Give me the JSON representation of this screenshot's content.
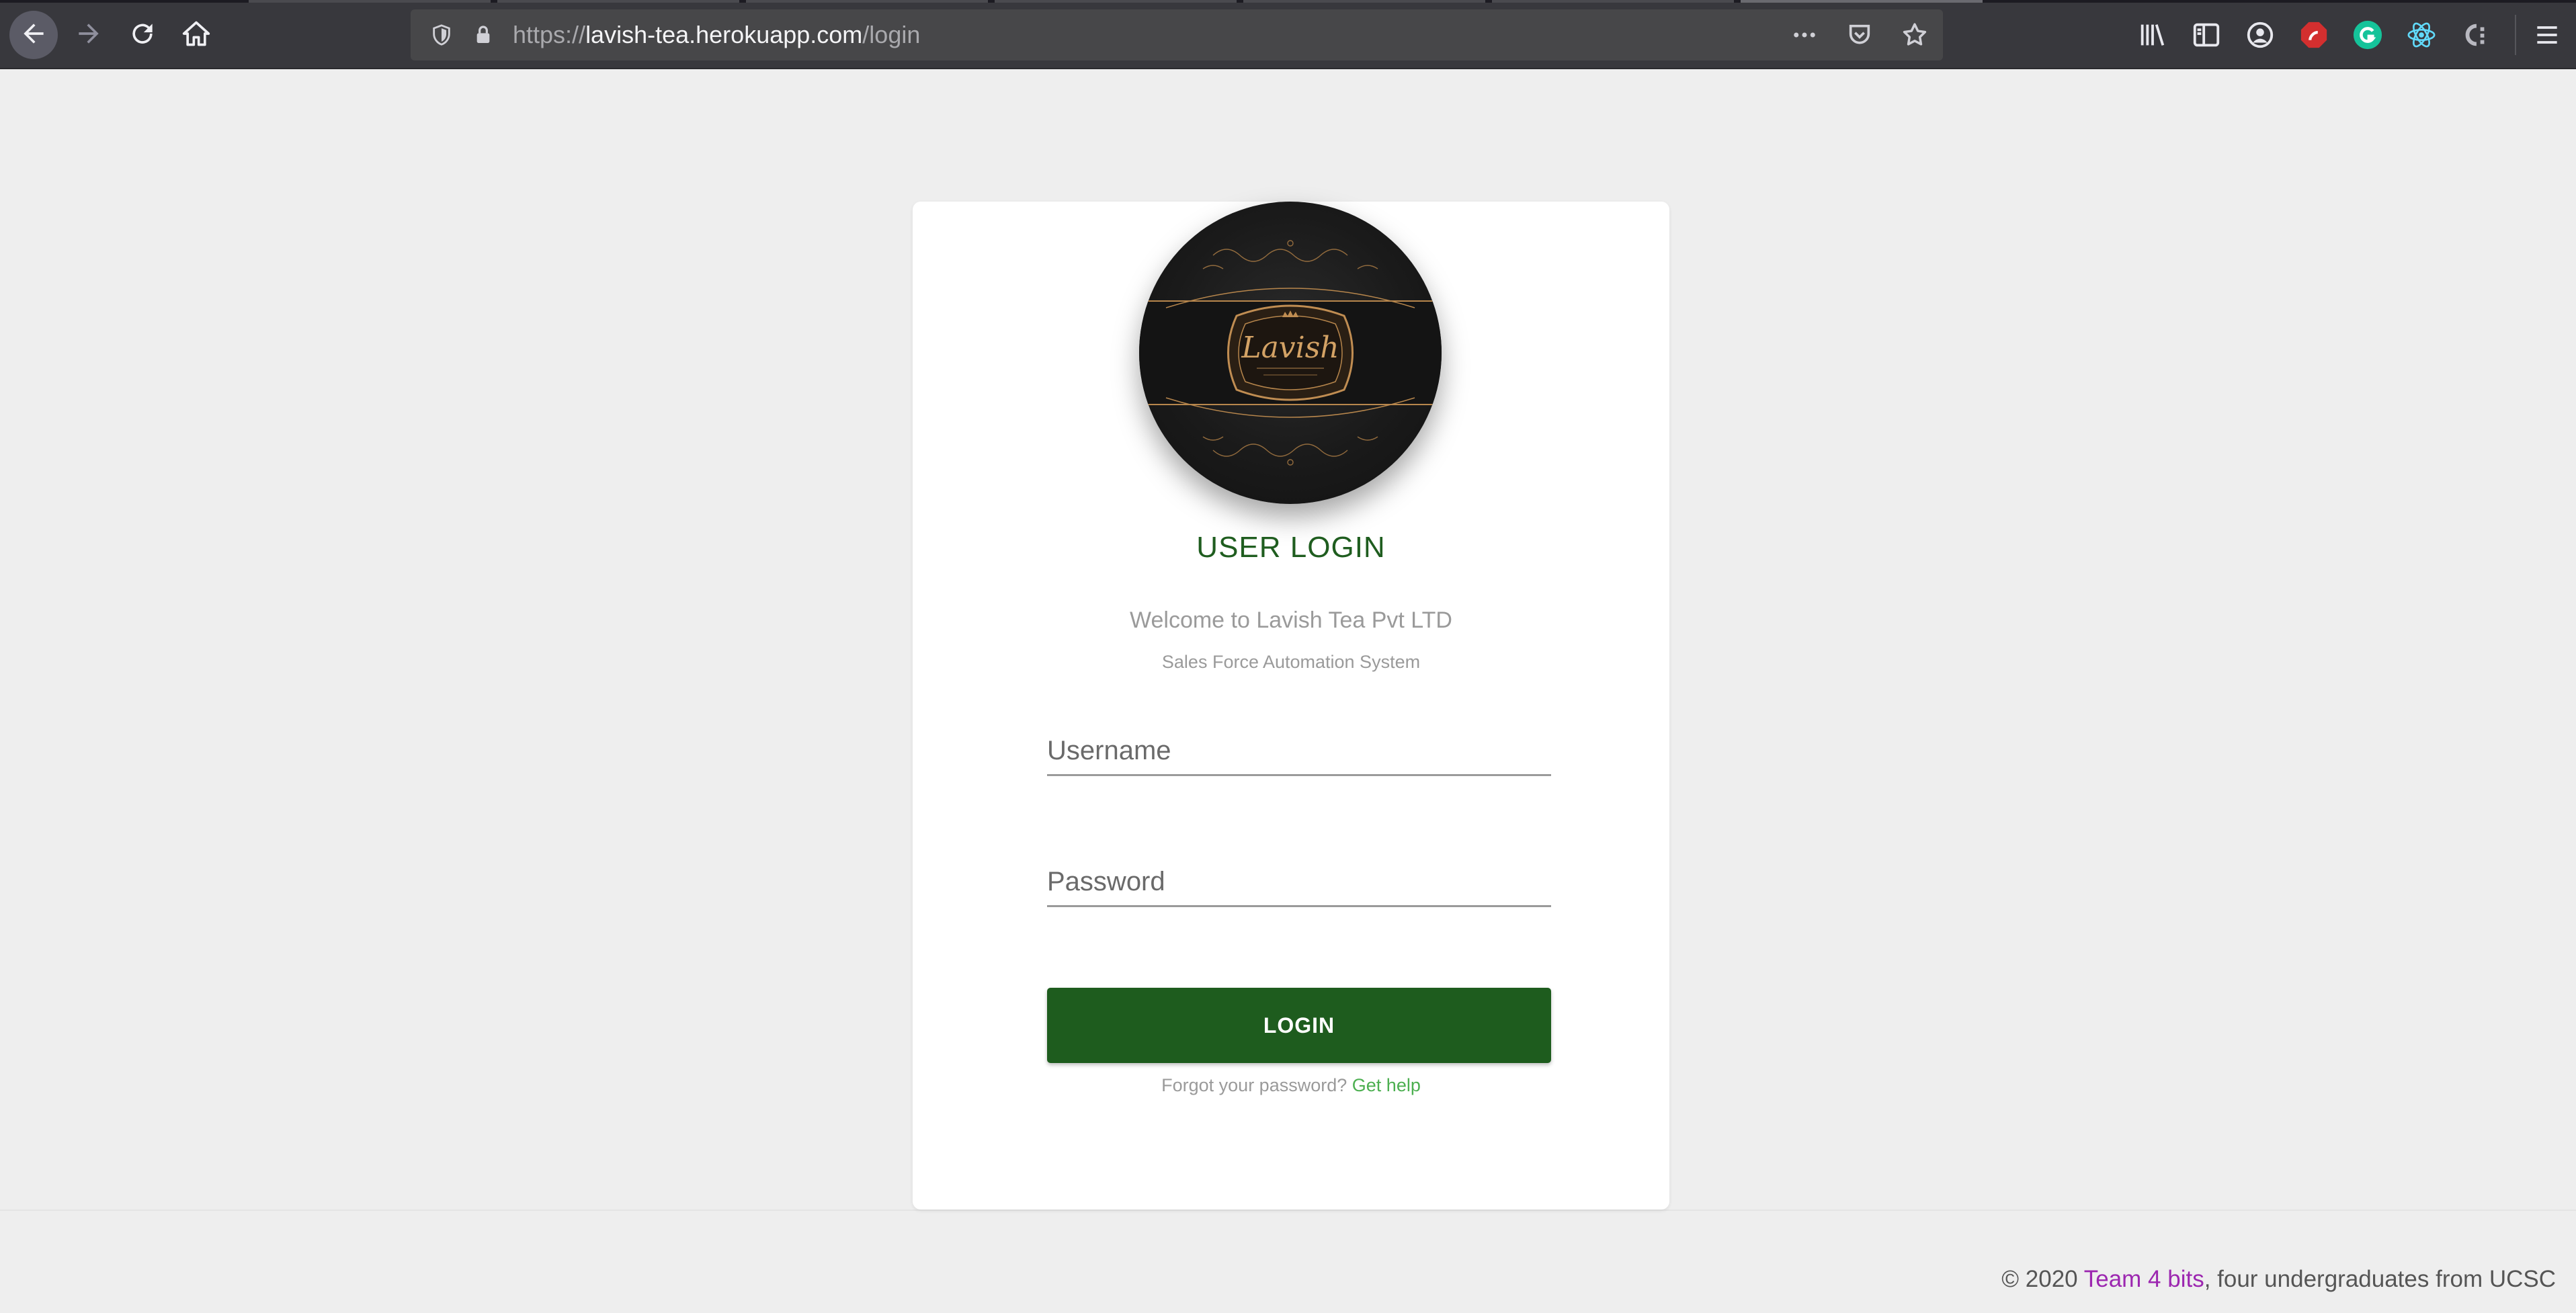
{
  "browser": {
    "url_scheme": "https://",
    "url_host": "lavish-tea.herokuapp.com",
    "url_path": "/login",
    "icons": {
      "back": "back-arrow-icon",
      "forward": "forward-arrow-icon",
      "reload": "reload-icon",
      "home": "home-icon",
      "tracking": "shield-icon",
      "lock": "lock-icon",
      "more": "more-dots-icon",
      "pocket": "pocket-icon",
      "bookmark": "star-icon",
      "library": "library-icon",
      "sidebar": "sidebar-icon",
      "account": "account-icon",
      "menu": "hamburger-menu-icon"
    },
    "extensions": [
      "adblock-icon",
      "grammarly-icon",
      "react-devtools-icon",
      "css-extension-icon"
    ]
  },
  "login": {
    "logo_alt": "Lavish",
    "title": "USER LOGIN",
    "welcome": "Welcome to Lavish Tea Pvt LTD",
    "subtitle": "Sales Force Automation System",
    "username_placeholder": "Username",
    "password_placeholder": "Password",
    "login_button": "LOGIN",
    "forgot_text": "Forgot your password?",
    "help_link": "Get help"
  },
  "footer": {
    "copyright": "© 2020",
    "team_link": "Team 4 bits",
    "rest": ", four undergraduates from UCSC"
  },
  "colors": {
    "accent_green": "#1e5c1e",
    "help_green": "#4caf50",
    "team_purple": "#9c27b0",
    "page_bg": "#eeeeee",
    "toolbar_bg": "#38383d"
  }
}
